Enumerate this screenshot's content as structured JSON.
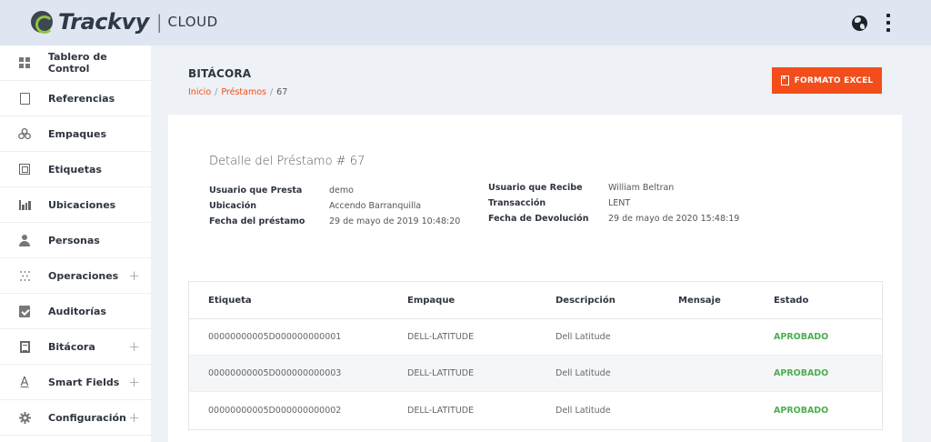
{
  "app": {
    "brand": "Trackvy",
    "product": "CLOUD"
  },
  "sidebar": {
    "items": [
      {
        "label": "Tablero de Control",
        "icon": "dashboard-icon",
        "expandable": false
      },
      {
        "label": "Referencias",
        "icon": "document-icon",
        "expandable": false
      },
      {
        "label": "Empaques",
        "icon": "boxes-icon",
        "expandable": false
      },
      {
        "label": "Etiquetas",
        "icon": "tag-icon",
        "expandable": false
      },
      {
        "label": "Ubicaciones",
        "icon": "chart-icon",
        "expandable": false
      },
      {
        "label": "Personas",
        "icon": "person-icon",
        "expandable": false
      },
      {
        "label": "Operaciones",
        "icon": "operations-icon",
        "expandable": true
      },
      {
        "label": "Auditorías",
        "icon": "clipboard-check-icon",
        "expandable": false
      },
      {
        "label": "Bitácora",
        "icon": "log-icon",
        "expandable": true
      },
      {
        "label": "Smart Fields",
        "icon": "smart-fields-icon",
        "expandable": true
      },
      {
        "label": "Configuración",
        "icon": "gear-icon",
        "expandable": true
      }
    ],
    "expand_symbol": "+"
  },
  "header": {
    "title": "BITÁCORA",
    "breadcrumb": [
      "Inicio",
      "Préstamos",
      "67"
    ],
    "breadcrumb_sep": "/",
    "excel_button": "FORMATO EXCEL"
  },
  "detail": {
    "title": "Detalle del Préstamo # 67",
    "left": [
      {
        "key": "Usuario que Presta",
        "value": "demo"
      },
      {
        "key": "Ubicación",
        "value": "Accendo Barranquilla"
      },
      {
        "key": "Fecha del préstamo",
        "value": "29 de mayo de 2019 10:48:20"
      }
    ],
    "right": [
      {
        "key": "Usuario que Recibe",
        "value": "William Beltran"
      },
      {
        "key": "Transacción",
        "value": "LENT"
      },
      {
        "key": "Fecha de Devolución",
        "value": "29 de mayo de 2020 15:48:19"
      }
    ]
  },
  "table": {
    "columns": [
      "Etiqueta",
      "Empaque",
      "Descripción",
      "Mensaje",
      "Estado"
    ],
    "rows": [
      [
        "00000000005D000000000001",
        "DELL-LATITUDE",
        "Dell Latitude",
        "",
        "APROBADO"
      ],
      [
        "00000000005D000000000003",
        "DELL-LATITUDE",
        "Dell Latitude",
        "",
        "APROBADO"
      ],
      [
        "00000000005D000000000002",
        "DELL-LATITUDE",
        "Dell Latitude",
        "",
        "APROBADO"
      ]
    ]
  },
  "colors": {
    "accent": "#f24d1a",
    "success": "#4caf50",
    "topbar": "#dfe6f1"
  }
}
